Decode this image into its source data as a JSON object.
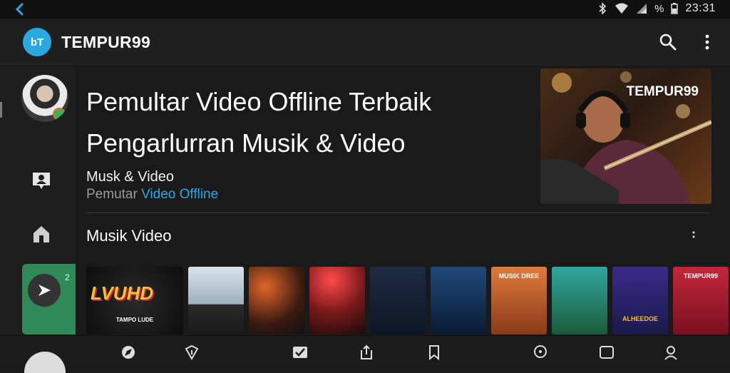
{
  "status": {
    "time": "23:31",
    "battery_label": "%"
  },
  "appbar": {
    "logo_text": "bT",
    "title": "TEMPUR99"
  },
  "headline": {
    "line1": "Pemultar Video Offline Terbaik",
    "line2": "Pengarlurran Musik & Video"
  },
  "subtitle": {
    "line1": "Musk & Video",
    "line2_prefix": "Pemutar ",
    "line2_highlight": "Video Offline"
  },
  "hero": {
    "brand": "TEMPUR99"
  },
  "section": {
    "title": "Musik Video"
  },
  "rail": {
    "active_badge": "2"
  },
  "thumbnails": [
    {
      "caption": "",
      "big": "LVUHD",
      "sub": "TAMPO LUDE",
      "style": "wide"
    },
    {
      "caption": "",
      "big": "",
      "sub": ""
    },
    {
      "caption": "",
      "big": "",
      "sub": ""
    },
    {
      "caption": "",
      "big": "",
      "sub": ""
    },
    {
      "caption": "",
      "big": "",
      "sub": ""
    },
    {
      "caption": "",
      "big": "",
      "sub": ""
    },
    {
      "caption": "MUSIK DREE",
      "big": "",
      "sub": ""
    },
    {
      "caption": "",
      "big": "",
      "sub": ""
    },
    {
      "caption": "",
      "big": "ALHEEDOE",
      "sub": ""
    },
    {
      "caption": "TEMPUR99",
      "big": "",
      "sub": ""
    }
  ],
  "colors": {
    "accent": "#2aa9e0",
    "rail_active": "#2e8b57",
    "background": "#1a1a1a"
  }
}
